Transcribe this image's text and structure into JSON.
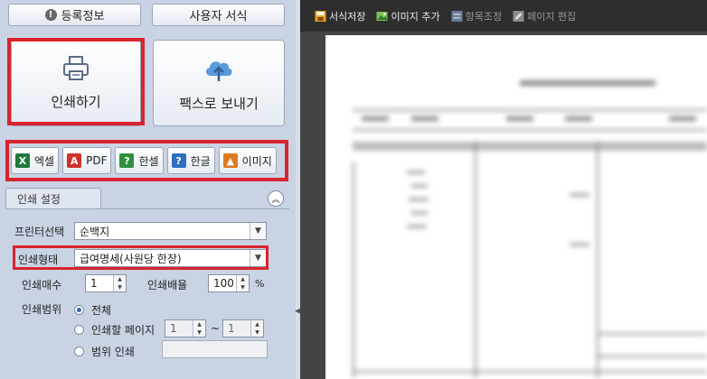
{
  "left": {
    "top_buttons": {
      "register_info": "등록정보",
      "user_format": "사용자 서식"
    },
    "big_buttons": {
      "print": "인쇄하기",
      "fax": "팩스로 보내기"
    },
    "export_buttons": [
      {
        "label": "엑셀",
        "icon": "excel-icon",
        "color": "#1f7a3a",
        "glyph": "X"
      },
      {
        "label": "PDF",
        "icon": "pdf-icon",
        "color": "#d0312d",
        "glyph": "A"
      },
      {
        "label": "한셀",
        "icon": "hancell-icon",
        "color": "#2f8f3e",
        "glyph": "?"
      },
      {
        "label": "한글",
        "icon": "hangul-icon",
        "color": "#2f6fc0",
        "glyph": "?"
      },
      {
        "label": "이미지",
        "icon": "image-icon",
        "color": "#e07a1f",
        "glyph": "▲"
      }
    ],
    "print_settings": {
      "tab_label": "인쇄 설정",
      "printer_label": "프린터선택",
      "printer_value": "순백지",
      "type_label": "인쇄형태",
      "type_value": "급여명세(사원당 한장)",
      "copies_label": "인쇄매수",
      "copies_value": "1",
      "scale_label": "인쇄배율",
      "scale_value": "100",
      "scale_unit": "%",
      "range_label": "인쇄범위",
      "range_all": "전체",
      "range_pages": "인쇄할 페이지",
      "page_from": "1",
      "page_sep": "~",
      "page_to": "1",
      "range_custom": "범위 인쇄"
    }
  },
  "toolbar": {
    "save_format": "서식저장",
    "add_image": "이미지 추가",
    "adjust_items": "항목조정",
    "edit_page": "페이지 편집"
  },
  "colors": {
    "highlight": "#d9232e",
    "panel": "#c9d3e3",
    "toolbar": "#2e2e2e"
  }
}
